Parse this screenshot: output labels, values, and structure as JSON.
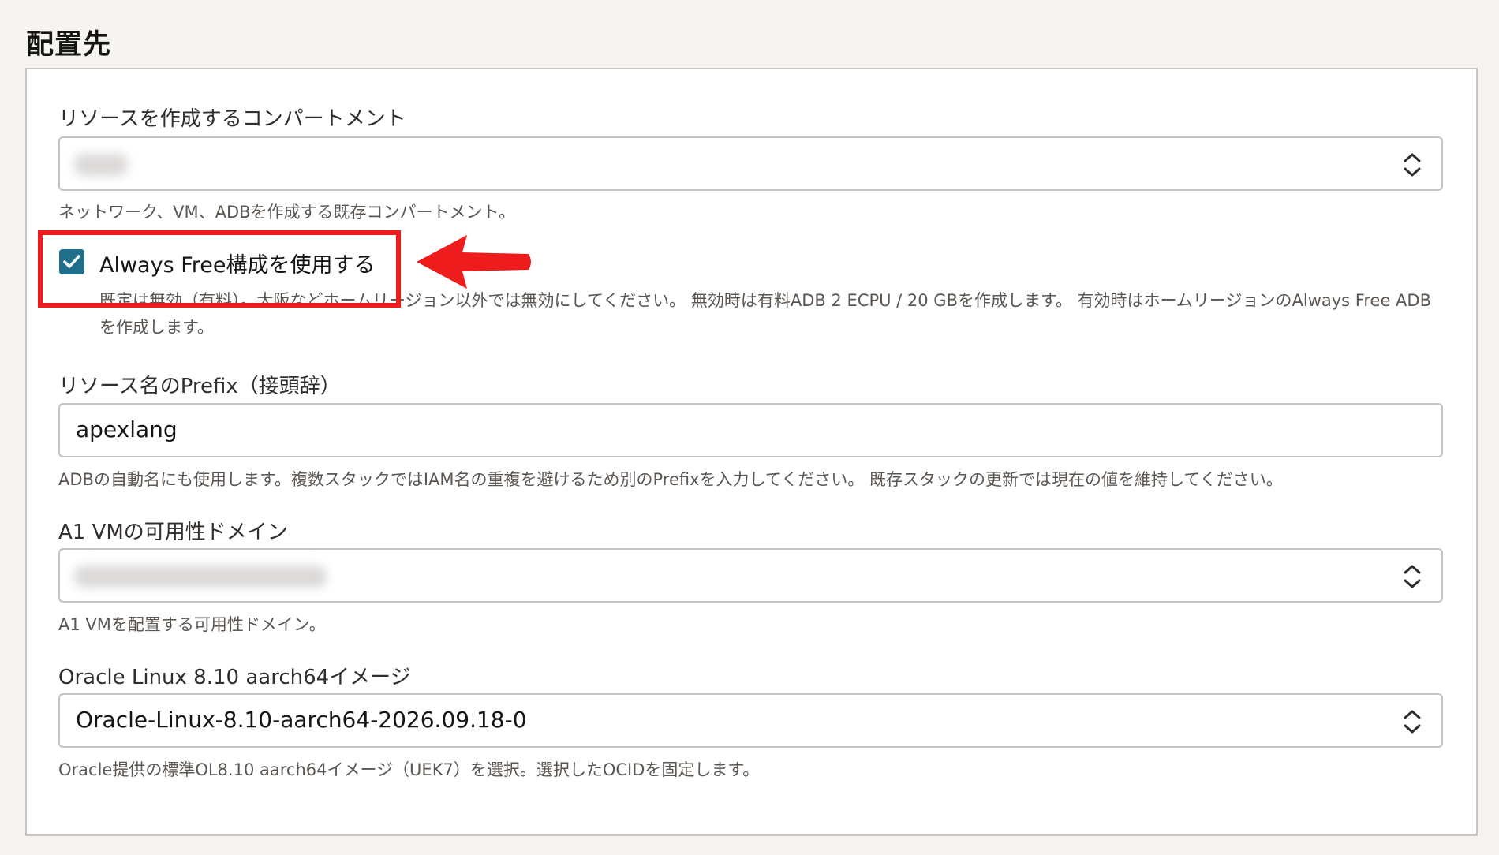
{
  "section": {
    "title": "配置先"
  },
  "compartment": {
    "label": "リソースを作成するコンパートメント",
    "help": "ネットワーク、VM、ADBを作成する既存コンパートメント。"
  },
  "always_free": {
    "label": "Always Free構成を使用する",
    "checked": true,
    "help": "既定は無効（有料）。大阪などホームリージョン以外では無効にしてください。 無効時は有料ADB 2 ECPU / 20 GBを作成します。 有効時はホームリージョンのAlways Free ADBを作成します。"
  },
  "prefix": {
    "label": "リソース名のPrefix（接頭辞）",
    "value": "apexlang",
    "help": "ADBの自動名にも使用します。複数スタックではIAM名の重複を避けるため別のPrefixを入力してください。 既存スタックの更新では現在の値を維持してください。"
  },
  "availability_domain": {
    "label": "A1 VMの可用性ドメイン",
    "help": "A1 VMを配置する可用性ドメイン。"
  },
  "image": {
    "label": "Oracle Linux 8.10 aarch64イメージ",
    "value": "Oracle-Linux-8.10-aarch64-2026.09.18-0",
    "help": "Oracle提供の標準OL8.10 aarch64イメージ（UEK7）を選択。選択したOCIDを固定します。"
  },
  "colors": {
    "checkbox_accent": "#1f6f8b",
    "annotation_red": "#ee1c1c"
  }
}
